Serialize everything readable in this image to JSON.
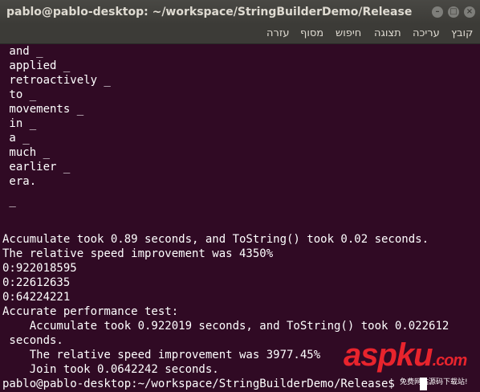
{
  "window": {
    "title": "pablo@pablo-desktop: ~/workspace/StringBuilderDemo/Release",
    "minimize_glyph": "–",
    "maximize_glyph": "□",
    "close_glyph": "×"
  },
  "menubar": {
    "items": [
      "קובץ",
      "עריכה",
      "תצוגה",
      "חיפוש",
      "מסוף",
      "עזרה"
    ]
  },
  "terminal": {
    "lines": [
      " and _",
      " applied _",
      " retroactively _",
      " to _",
      " movements _",
      " in _",
      " a _",
      " much _",
      " earlier _",
      " era.",
      "",
      " _",
      "",
      "",
      "Accumulate took 0.89 seconds, and ToString() took 0.02 seconds.",
      "The relative speed improvement was 4350%",
      "0:922018595",
      "0:22612635",
      "0:64224221",
      "Accurate performance test:",
      "    Accumulate took 0.922019 seconds, and ToString() took 0.022612",
      " seconds.",
      "    The relative speed improvement was 3977.45%",
      "    Join took 0.0642242 seconds.",
      "pablo@pablo-desktop:~/workspace/StringBuilderDemo/Release$ "
    ]
  },
  "watermark": {
    "logo": "aspku",
    "logo_suffix": ".com",
    "subtitle": "免费网站源码下载站!"
  },
  "colors": {
    "terminal_bg": "#300a24",
    "titlebar_bg": "#3c3b37",
    "text": "#ffffff",
    "watermark_red": "#e8242d"
  }
}
